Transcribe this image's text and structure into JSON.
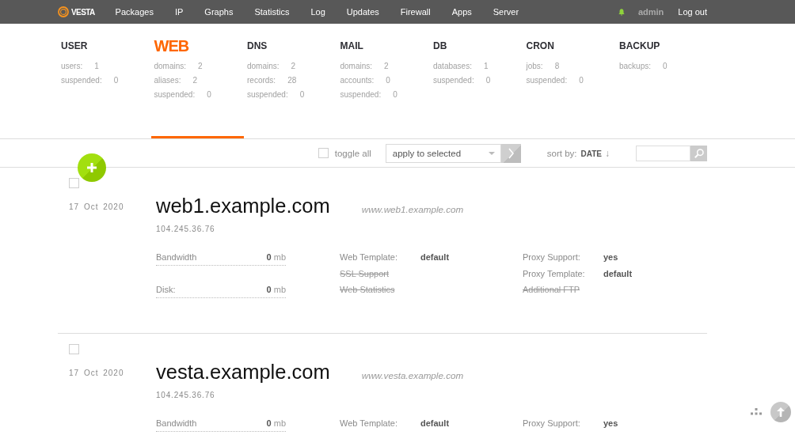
{
  "top_nav": {
    "logo": "VESTA",
    "links": [
      "Packages",
      "IP",
      "Graphs",
      "Statistics",
      "Log",
      "Updates",
      "Firewall",
      "Apps",
      "Server"
    ],
    "user": "admin",
    "logout": "Log out"
  },
  "overview": [
    {
      "title": "USER",
      "selected": false,
      "stats": [
        {
          "label": "users:",
          "value": "1"
        },
        {
          "label": "suspended:",
          "value": "0"
        }
      ]
    },
    {
      "title": "WEB",
      "selected": true,
      "stats": [
        {
          "label": "domains:",
          "value": "2"
        },
        {
          "label": "aliases:",
          "value": "2"
        },
        {
          "label": "suspended:",
          "value": "0"
        }
      ]
    },
    {
      "title": "DNS",
      "selected": false,
      "stats": [
        {
          "label": "domains:",
          "value": "2"
        },
        {
          "label": "records:",
          "value": "28"
        },
        {
          "label": "suspended:",
          "value": "0"
        }
      ]
    },
    {
      "title": "MAIL",
      "selected": false,
      "stats": [
        {
          "label": "domains:",
          "value": "2"
        },
        {
          "label": "accounts:",
          "value": "0"
        },
        {
          "label": "suspended:",
          "value": "0"
        }
      ]
    },
    {
      "title": "DB",
      "selected": false,
      "stats": [
        {
          "label": "databases:",
          "value": "1"
        },
        {
          "label": "suspended:",
          "value": "0"
        }
      ]
    },
    {
      "title": "CRON",
      "selected": false,
      "stats": [
        {
          "label": "jobs:",
          "value": "8"
        },
        {
          "label": "suspended:",
          "value": "0"
        }
      ]
    },
    {
      "title": "BACKUP",
      "selected": false,
      "stats": [
        {
          "label": "backups:",
          "value": "0"
        }
      ]
    }
  ],
  "toolbar": {
    "toggle_all": {
      "label": "toggle all",
      "checked": false
    },
    "action": {
      "value": "apply to selected"
    },
    "sort": {
      "label": "sort by:",
      "value": "DATE",
      "direction": "↓"
    }
  },
  "items": [
    {
      "checked": false,
      "date": "17 Oct 2020",
      "domain": "web1.example.com",
      "alias": "www.web1.example.com",
      "ip": "104.245.36.76",
      "usage": [
        {
          "label": "Bandwidth",
          "value": "0",
          "unit": "mb"
        },
        {
          "label": "Disk:",
          "value": "0",
          "unit": "mb"
        }
      ],
      "web": [
        {
          "label": "Web Template:",
          "value": "default",
          "enabled": true
        },
        {
          "label": "SSL Support",
          "enabled": false
        },
        {
          "label": "Web Statistics",
          "enabled": false
        }
      ],
      "proxy": [
        {
          "label": "Proxy Support:",
          "value": "yes",
          "enabled": true
        },
        {
          "label": "Proxy Template:",
          "value": "default",
          "enabled": true
        },
        {
          "label": "Additional FTP",
          "enabled": false
        }
      ]
    },
    {
      "checked": false,
      "date": "17 Oct 2020",
      "domain": "vesta.example.com",
      "alias": "www.vesta.example.com",
      "ip": "104.245.36.76",
      "usage": [
        {
          "label": "Bandwidth",
          "value": "0",
          "unit": "mb"
        }
      ],
      "web": [
        {
          "label": "Web Template:",
          "value": "default",
          "enabled": true
        }
      ],
      "proxy": [
        {
          "label": "Proxy Support:",
          "value": "yes",
          "enabled": true
        }
      ]
    }
  ]
}
